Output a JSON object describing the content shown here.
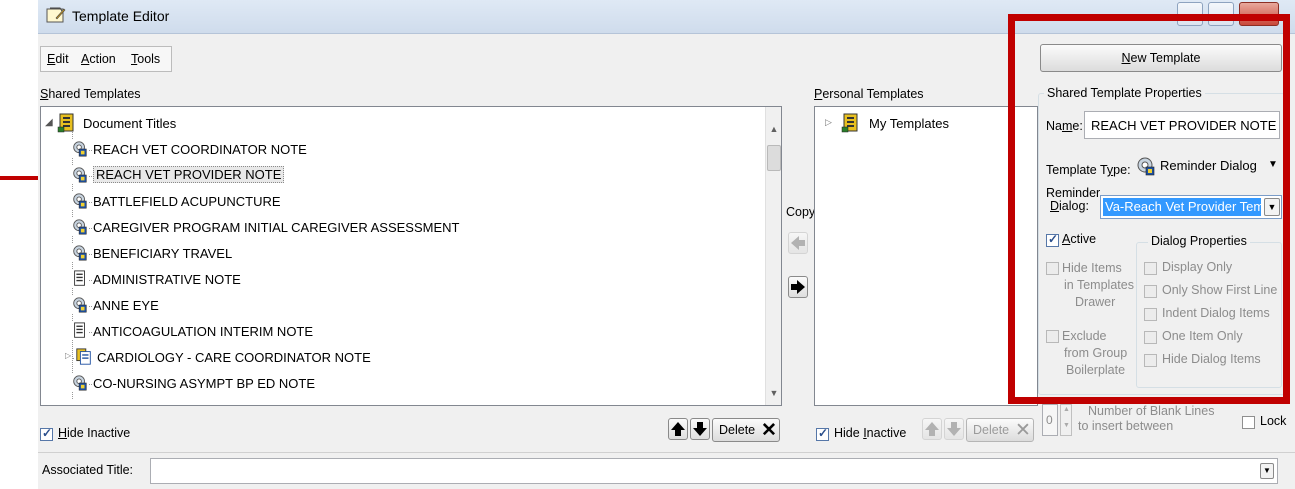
{
  "window": {
    "title": "Template Editor"
  },
  "menu": {
    "edit": {
      "hot": "E",
      "rest": "dit"
    },
    "action": {
      "hot": "A",
      "rest": "ction"
    },
    "tools": {
      "hot": "T",
      "rest": "ools"
    }
  },
  "shared": {
    "label_hot": "S",
    "label_rest": "hared Templates",
    "root": "Document Titles",
    "items": [
      {
        "label": "REACH VET COORDINATOR NOTE",
        "icon": "reminder-dialog-icon"
      },
      {
        "label": "REACH VET PROVIDER NOTE",
        "icon": "reminder-dialog-icon",
        "selected": true
      },
      {
        "label": "BATTLEFIELD ACUPUNCTURE",
        "icon": "reminder-dialog-icon"
      },
      {
        "label": "CAREGIVER PROGRAM INITIAL CAREGIVER ASSESSMENT",
        "icon": "reminder-dialog-icon"
      },
      {
        "label": "BENEFICIARY TRAVEL",
        "icon": "reminder-dialog-icon"
      },
      {
        "label": "ADMINISTRATIVE NOTE",
        "icon": "document-icon"
      },
      {
        "label": "ANNE EYE",
        "icon": "reminder-dialog-icon"
      },
      {
        "label": "ANTICOAGULATION INTERIM NOTE",
        "icon": "document-icon"
      },
      {
        "label": "CARDIOLOGY - CARE COORDINATOR NOTE",
        "icon": "group-template-icon"
      },
      {
        "label": "CO-NURSING ASYMPT BP ED NOTE",
        "icon": "reminder-dialog-icon"
      }
    ],
    "hide_inactive_hot": "H",
    "hide_inactive_rest": "ide Inactive",
    "delete_label": "Delete"
  },
  "copy_label": "Copy",
  "personal": {
    "label_hot": "P",
    "label_rest": "ersonal Templates",
    "root": "My Templates",
    "hide_inactive_pre": "Hide ",
    "hide_inactive_hot": "I",
    "hide_inactive_rest": "nactive",
    "delete_label": "Delete"
  },
  "properties": {
    "new_template_hot": "N",
    "new_template_rest": "ew Template",
    "group_title": "Shared Template Properties",
    "name_label_pre": "Na",
    "name_label_hot": "m",
    "name_label_rest": "e:",
    "name_value": "REACH VET PROVIDER NOTE",
    "type_label_pre": "Template T",
    "type_label_hot": "y",
    "type_label_rest": "pe:",
    "type_value": "Reminder Dialog",
    "reminder_label_1": "Reminder",
    "reminder_label_2_hot": "D",
    "reminder_label_2_rest": "ialog:",
    "reminder_value": "Va-Reach Vet Provider Temp",
    "active_hot": "A",
    "active_rest": "ctive",
    "hide_items": [
      "Hide Items",
      "in Templates",
      "Drawer"
    ],
    "exclude": [
      "Exclude",
      "from Group",
      "Boilerplate"
    ],
    "dialog_props_title": "Dialog Properties",
    "dialog_props": [
      "Display Only",
      "Only Show First Line",
      "Indent Dialog Items",
      "One Item Only",
      "Hide Dialog Items"
    ],
    "blank_lines_value": "0",
    "blank_lines_label_1": "Number of Blank Lines",
    "blank_lines_label_2": "to insert between",
    "lock_label": "Lock"
  },
  "associated_title_label": "Associated Title:",
  "colors": {
    "annotation": "#c00000",
    "selection": "#3399ff"
  }
}
